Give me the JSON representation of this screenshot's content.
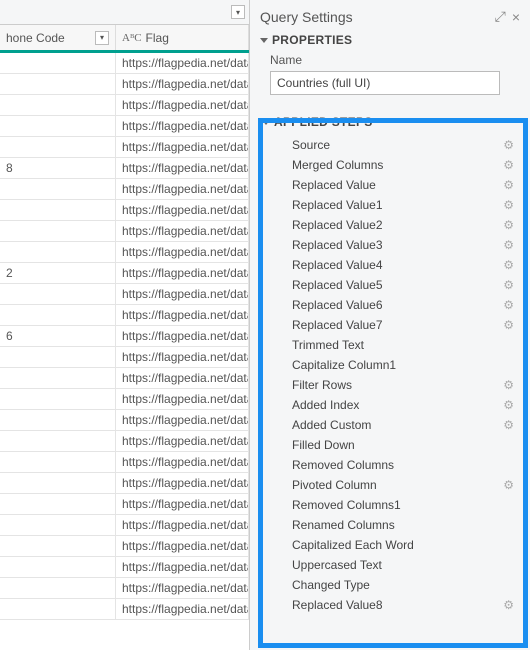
{
  "left": {
    "col_phone": "hone Code",
    "col_flag": "Flag",
    "text_icon": "AᴮC",
    "rows": [
      {
        "phone": "",
        "flag": "https://flagpedia.net/data"
      },
      {
        "phone": "",
        "flag": "https://flagpedia.net/data"
      },
      {
        "phone": "",
        "flag": "https://flagpedia.net/data"
      },
      {
        "phone": "",
        "flag": "https://flagpedia.net/data"
      },
      {
        "phone": "",
        "flag": "https://flagpedia.net/data"
      },
      {
        "phone": "8",
        "flag": "https://flagpedia.net/data"
      },
      {
        "phone": "",
        "flag": "https://flagpedia.net/data"
      },
      {
        "phone": "",
        "flag": "https://flagpedia.net/data"
      },
      {
        "phone": "",
        "flag": "https://flagpedia.net/data"
      },
      {
        "phone": "",
        "flag": "https://flagpedia.net/data"
      },
      {
        "phone": "2",
        "flag": "https://flagpedia.net/data"
      },
      {
        "phone": "",
        "flag": "https://flagpedia.net/data"
      },
      {
        "phone": "",
        "flag": "https://flagpedia.net/data"
      },
      {
        "phone": "6",
        "flag": "https://flagpedia.net/data"
      },
      {
        "phone": "",
        "flag": "https://flagpedia.net/data"
      },
      {
        "phone": "",
        "flag": "https://flagpedia.net/data"
      },
      {
        "phone": "",
        "flag": "https://flagpedia.net/data"
      },
      {
        "phone": "",
        "flag": "https://flagpedia.net/data"
      },
      {
        "phone": "",
        "flag": "https://flagpedia.net/data"
      },
      {
        "phone": "",
        "flag": "https://flagpedia.net/data"
      },
      {
        "phone": "",
        "flag": "https://flagpedia.net/data"
      },
      {
        "phone": "",
        "flag": "https://flagpedia.net/data"
      },
      {
        "phone": "",
        "flag": "https://flagpedia.net/data"
      },
      {
        "phone": "",
        "flag": "https://flagpedia.net/data"
      },
      {
        "phone": "",
        "flag": "https://flagpedia.net/data"
      },
      {
        "phone": "",
        "flag": "https://flagpedia.net/data"
      },
      {
        "phone": "",
        "flag": "https://flagpedia.net/data"
      }
    ]
  },
  "right": {
    "header": "Query Settings",
    "properties_title": "PROPERTIES",
    "name_label": "Name",
    "name_value": "Countries (full UI)",
    "steps_title": "APPLIED STEPS",
    "steps": [
      {
        "label": "Source",
        "gear": true
      },
      {
        "label": "Merged Columns",
        "gear": true
      },
      {
        "label": "Replaced Value",
        "gear": true
      },
      {
        "label": "Replaced Value1",
        "gear": true
      },
      {
        "label": "Replaced Value2",
        "gear": true
      },
      {
        "label": "Replaced Value3",
        "gear": true
      },
      {
        "label": "Replaced Value4",
        "gear": true
      },
      {
        "label": "Replaced Value5",
        "gear": true
      },
      {
        "label": "Replaced Value6",
        "gear": true
      },
      {
        "label": "Replaced Value7",
        "gear": true
      },
      {
        "label": "Trimmed Text",
        "gear": false
      },
      {
        "label": "Capitalize Column1",
        "gear": false
      },
      {
        "label": "Filter Rows",
        "gear": true
      },
      {
        "label": "Added Index",
        "gear": true
      },
      {
        "label": "Added Custom",
        "gear": true
      },
      {
        "label": "Filled Down",
        "gear": false
      },
      {
        "label": "Removed Columns",
        "gear": false
      },
      {
        "label": "Pivoted Column",
        "gear": true
      },
      {
        "label": "Removed Columns1",
        "gear": false
      },
      {
        "label": "Renamed Columns",
        "gear": false
      },
      {
        "label": "Capitalized Each Word",
        "gear": false
      },
      {
        "label": "Uppercased Text",
        "gear": false
      },
      {
        "label": "Changed Type",
        "gear": false
      },
      {
        "label": "Replaced Value8",
        "gear": true
      }
    ]
  }
}
